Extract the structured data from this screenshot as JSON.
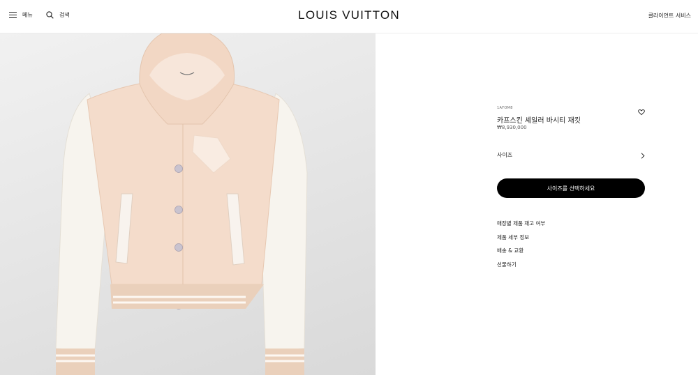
{
  "header": {
    "menu_label": "메뉴",
    "search_label": "검색",
    "logo": "LOUIS VUITTON",
    "client_service": "클라이언트 서비스"
  },
  "product": {
    "sku": "1AFOM8",
    "name": "카프스킨 셰일러 바시티 재킷",
    "price": "₩8,930,000",
    "size_label": "사이즈",
    "cta_label": "사이즈를 선택하세요",
    "links": [
      "매장별 제품 재고 여부",
      "제품 세부 정보",
      "배송 & 교환",
      "선물하기"
    ]
  },
  "colors": {
    "jacket_body": "#f4dccb",
    "sleeves": "#f7f4ee",
    "rib_trim": "#ead0bb",
    "cta_background": "#000000"
  },
  "icons": [
    "menu-icon",
    "search-icon",
    "heart-icon",
    "chevron-right-icon"
  ]
}
